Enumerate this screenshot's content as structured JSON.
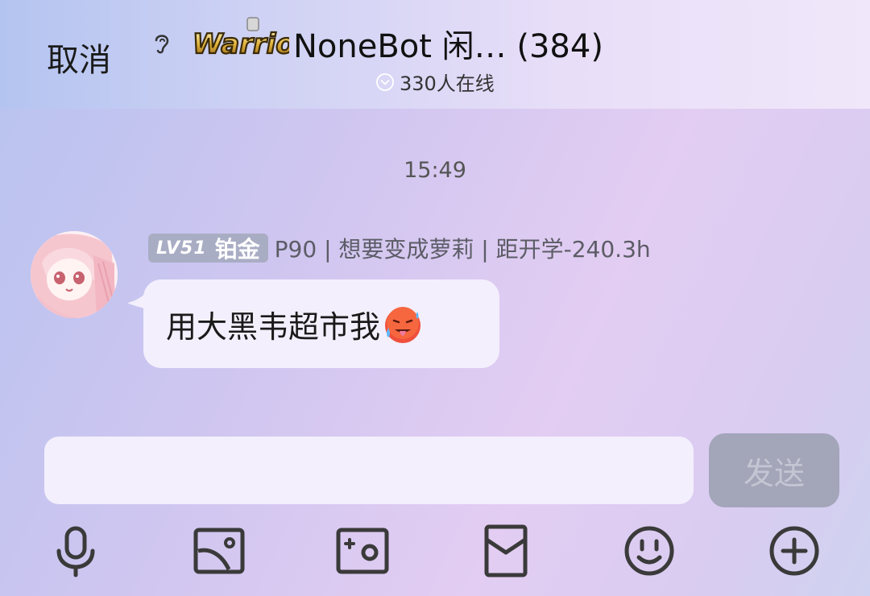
{
  "header": {
    "cancel_label": "取消",
    "logo_text": "Warrior",
    "title": "NoneBot 闲… (384)",
    "online_count": "330人在线"
  },
  "chat": {
    "timestamp": "15:49",
    "message": {
      "level": "LV51",
      "rank": "铂金",
      "sender": "P90 | 想要变成萝莉 | 距开学-240.3h",
      "text": "用大黑韦超市我",
      "emoji": "hot-face-emoji"
    }
  },
  "composer": {
    "input_value": "",
    "send_label": "发送"
  },
  "toolbar": {
    "items": [
      "microphone-icon",
      "image-icon",
      "camera-icon",
      "red-packet-icon",
      "emoji-icon",
      "plus-icon"
    ]
  },
  "colors": {
    "badge_bg": "#a9adc4",
    "bubble_bg": "#f3effc",
    "send_disabled_bg": "#a3a5b8"
  }
}
